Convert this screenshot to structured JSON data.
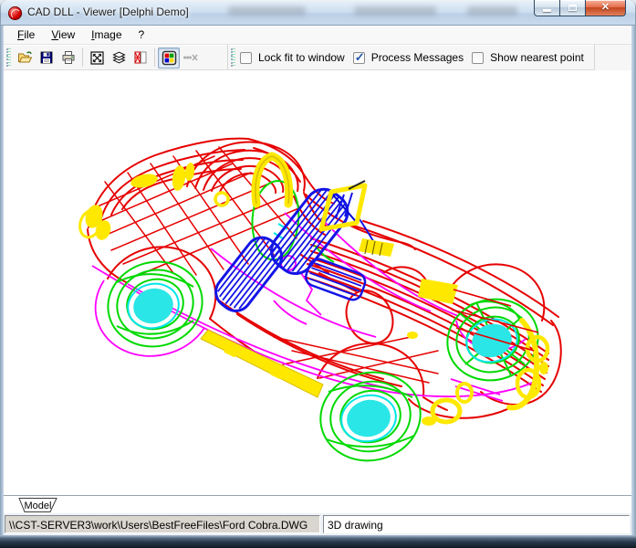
{
  "window": {
    "title": "CAD DLL - Viewer [Delphi Demo]"
  },
  "menu": {
    "items": [
      {
        "label": "File",
        "accel": true
      },
      {
        "label": "View",
        "accel": true
      },
      {
        "label": "Image",
        "accel": true
      },
      {
        "label": "?",
        "accel": false
      }
    ]
  },
  "toolbar": {
    "buttons": [
      {
        "name": "open",
        "icon": "open-folder-icon"
      },
      {
        "name": "save",
        "icon": "save-icon"
      },
      {
        "name": "print",
        "icon": "print-icon"
      },
      {
        "name": "fit-to-window",
        "icon": "fit-icon"
      },
      {
        "name": "layers",
        "icon": "layers-icon"
      },
      {
        "name": "entities",
        "icon": "entities-icon"
      },
      {
        "name": "palette",
        "icon": "palette-icon",
        "pressed": true
      },
      {
        "name": "measure",
        "icon": "measure-icon",
        "disabled": true
      }
    ],
    "checkboxes": [
      {
        "label": "Lock fit to window",
        "checked": false
      },
      {
        "label": "Process Messages",
        "checked": true
      },
      {
        "label": "Show nearest point",
        "checked": false
      }
    ]
  },
  "drawing": {
    "description": "3D wireframe CAD drawing of a Ford Cobra sports car",
    "palette": {
      "red": "#e60000",
      "green": "#00d900",
      "cyan": "#00e6e6",
      "blue": "#1414e6",
      "magenta": "#ff00ff",
      "yellow": "#ffe800"
    }
  },
  "tabs": {
    "model_label": "Model"
  },
  "statusbar": {
    "file_path": "\\\\CST-SERVER3\\work\\Users\\BestFreeFiles\\Ford Cobra.DWG",
    "drawing_type": "3D drawing"
  }
}
